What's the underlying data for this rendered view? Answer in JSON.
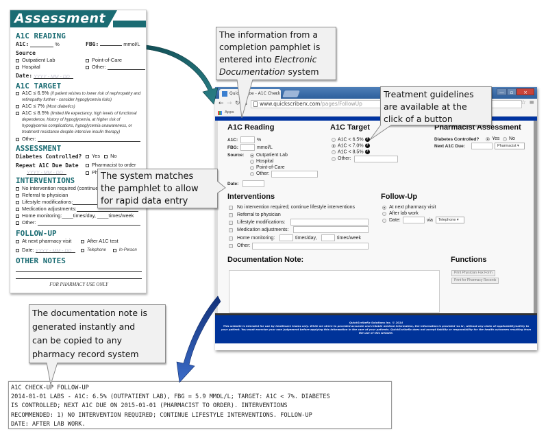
{
  "pamphlet": {
    "title": "Assessment",
    "a1c_reading": {
      "heading": "A1C READING",
      "a1c_label": "A1C:",
      "a1c_unit": "%",
      "fbg_label": "FBG:",
      "fbg_unit": "mmol/L",
      "source_label": "Source",
      "sources": [
        "Outpatient Lab",
        "Hospital",
        "Point-of-Care",
        "Other:"
      ],
      "date_label": "Date:",
      "date_placeholder": "YYYY - MM - DD"
    },
    "a1c_target": {
      "heading": "A1C TARGET",
      "options": [
        {
          "label": "A1C ≤ 6.5%",
          "note": "(if patient wishes to lower risk of nephropathy and retinopathy further - consider hypoglycemia risks)"
        },
        {
          "label": "A1C ≤ 7%",
          "note": "(Most diabetics)"
        },
        {
          "label": "A1C ≤ 8.5%",
          "note": "(limited life expectancy, high levels of functional dependence, history of hypoglycemia, at higher risk of hypoglycemia complications, hypoglycemia unawareness, or treatment resistance despite intensive insulin therapy)"
        },
        {
          "label": "Other:",
          "note": ""
        }
      ]
    },
    "assessment": {
      "heading": "ASSESSMENT",
      "diabetes_controlled": "Diabetes Controlled?",
      "yes": "Yes",
      "no": "No",
      "repeat_due": "Repeat A1C Due Date",
      "pharmacist_to_order": "Pharmacist to order",
      "physician_to_order": "Physician to order",
      "date_placeholder": "YYYY - MM - DD"
    },
    "interventions": {
      "heading": "INTERVENTIONS",
      "items": [
        "No intervention required (continue",
        "Referral to physician",
        "Lifestyle modifications:",
        "Medication adjustments:",
        "Home monitoring:____times/day, ____times/week",
        "Other:"
      ]
    },
    "follow_up": {
      "heading": "FOLLOW-UP",
      "at_next_visit": "At next pharmacy visit",
      "after_test": "After A1C test",
      "date_label": "Date:",
      "date_placeholder": "YYYY - MM - DD",
      "telephone": "Telephone",
      "in_person": "In-Person"
    },
    "other_notes": {
      "heading": "OTHER NOTES"
    },
    "footer": "FOR PHARMACY USE ONLY"
  },
  "browser": {
    "tab_title": "QuickScribe - A1C Check",
    "tab_close": "×",
    "url_host": "www.quickscriberx.com",
    "url_path": "/pages/FollowUp",
    "bookmarks_apps": "Apps",
    "icons": {
      "back": "←",
      "forward": "→",
      "reload": "↻",
      "home": "⌂",
      "star": "☆",
      "menu": "≡",
      "minimize": "—",
      "maximize": "▫",
      "close": "×"
    }
  },
  "app": {
    "a1c_reading": {
      "heading": "A1C Reading",
      "a1c_label": "A1C:",
      "a1c_value": "",
      "a1c_unit": "%",
      "fbg_label": "FBG:",
      "fbg_value": "",
      "fbg_unit": "mmol/L",
      "source_label": "Source:",
      "sources": [
        {
          "label": "Outpatient Lab",
          "selected": true
        },
        {
          "label": "Hospital",
          "selected": false
        },
        {
          "label": "Point-of-Care",
          "selected": false
        },
        {
          "label": "Other:",
          "selected": false
        }
      ],
      "date_label": "Date:",
      "date_value": ""
    },
    "a1c_target": {
      "heading": "A1C Target",
      "options": [
        {
          "label": "A1C < 6.5%",
          "selected": false,
          "help": true
        },
        {
          "label": "A1C < 7.0%",
          "selected": true,
          "help": true
        },
        {
          "label": "A1C < 8.5%",
          "selected": false,
          "help": true
        },
        {
          "label": "Other:",
          "selected": false,
          "help": false
        }
      ],
      "help_icon": "?"
    },
    "pharmacist_assessment": {
      "heading": "Pharmacist Assessment",
      "diabetes_controlled": "Diabetes Controlled?",
      "yes": "Yes",
      "no": "No",
      "yes_selected": true,
      "next_due_label": "Next A1C Due:",
      "next_due_value": "",
      "orderer_selected": "Pharmacist ▾"
    },
    "interventions": {
      "heading": "Interventions",
      "items": [
        "No intervention required; continue lifestyle interventions",
        "Referral to physician",
        "Lifestyle modifications:",
        "Medication adjustments:",
        "Home monitoring:",
        "Other:"
      ],
      "times_day": "times/day,",
      "times_week": "times/week"
    },
    "follow_up": {
      "heading": "Follow-Up",
      "options": [
        {
          "label": "At next pharmacy visit",
          "selected": true
        },
        {
          "label": "After lab work",
          "selected": false
        },
        {
          "label": "Date:",
          "selected": false
        }
      ],
      "via_label": "via",
      "via_selected": "Telephone ▾"
    },
    "documentation_note": {
      "heading": "Documentation Note:",
      "value": ""
    },
    "functions": {
      "heading": "Functions",
      "buttons": [
        "Print Physician Fax Form",
        "Print for Pharmacy Records"
      ]
    },
    "footer": {
      "copyright": "QuickScribeRx Solutions Inc. © 2014",
      "disclaimer": "This website is intended for use by healthcare teams only. While we strive to provided accurate and reliable medical information, the information is provided 'as is', without any claim of applicability/safety to your patient. You must exercise your own judgement before applying this information in the care of your patients. QuickScribeRx does not accept liability or responsibility for the health outcomes resulting from the use of this website."
    }
  },
  "callouts": {
    "pamphlet_entered": "The information from a\ncompletion pamphlet is\nentered into ",
    "pamphlet_entered_em1": "Electronic",
    "pamphlet_entered_em2": "Documentation",
    "pamphlet_entered_end": " system",
    "guidelines": "Treatment guidelines\nare available at the\nclick of a button",
    "matches": "The system matches\nthe pamphlet to allow\nfor rapid data entry",
    "note_generated": "The documentation note is\ngenerated instantly and\ncan be copied to any\npharmacy  record system"
  },
  "generated_note": "A1C CHECK-UP FOLLOW-UP\n2014-01-01 LABS - A1C: 6.5% (OUTPATIENT LAB), FBG = 5.9 MMOL/L; TARGET: A1C < 7%. DIABETES\nIS CONTROLLED; NEXT A1C DUE ON 2015-01-01 (PHARMACIST TO ORDER). INTERVENTIONS\nRECOMMENDED: 1) NO INTERVENTION REQUIRED; CONTINUE LIFESTYLE INTERVENTIONS. FOLLOW-UP\nDATE: AFTER LAB WORK.",
  "colors": {
    "pamphlet_teal": "#1b6c73",
    "browser_blue": "#0033a0",
    "arrow_teal": "#1e6a70",
    "arrow_blue": "#1f4aa0"
  }
}
